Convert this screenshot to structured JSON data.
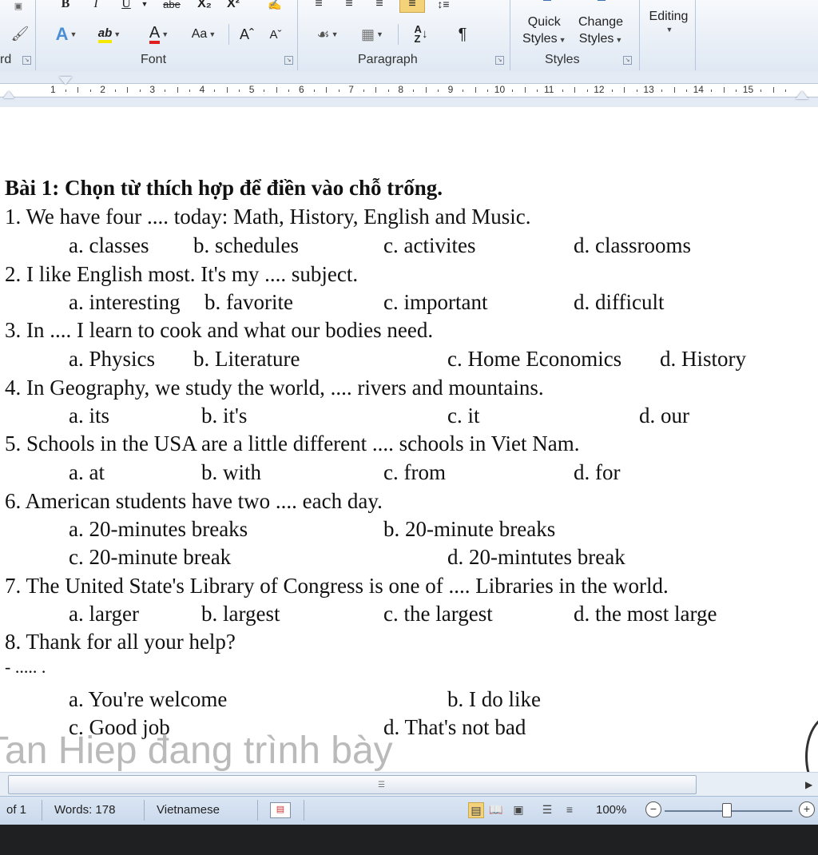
{
  "ribbon": {
    "font": {
      "bold": "B",
      "italic": "I",
      "underline": "U",
      "strike": "abe",
      "subscript": "X₂",
      "superscript": "X²",
      "font_color": "A",
      "highlight": "ab",
      "text_color": "A",
      "change_case": "Aa",
      "grow": "Aˆ",
      "shrink": "Aˇ",
      "label": "Font"
    },
    "paragraph": {
      "pilcrow": "¶",
      "label": "Paragraph"
    },
    "styles": {
      "quick_1": "Quick",
      "quick_2": "Styles",
      "change_1": "Change",
      "change_2": "Styles",
      "label": "Styles"
    },
    "editing": {
      "label": "Editing"
    },
    "clipboard_tail": "rd"
  },
  "ruler": {
    "numbers": [
      "1",
      "2",
      "3",
      "4",
      "5",
      "6",
      "7",
      "8",
      "9",
      "10",
      "11",
      "12",
      "13",
      "14",
      "15"
    ]
  },
  "document": {
    "title": "Bài 1: Chọn từ thích hợp để điền vào chỗ trống.",
    "questions": [
      {
        "q": "1. We have four .... today: Math, History, English and Music.",
        "a": "a. classes",
        "b": "b. schedules",
        "c": "c. activites",
        "d": "d. classrooms"
      },
      {
        "q": "2. I like English most. It's my .... subject.",
        "a": "a. interesting",
        "b": "b. favorite",
        "c": "c. important",
        "d": "d. difficult"
      },
      {
        "q": "3. In .... I learn to cook and what our bodies need.",
        "a": "a. Physics",
        "b": "b. Literature",
        "c": "c. Home Economics",
        "d": "d. History"
      },
      {
        "q": "4. In Geography, we study the world, .... rivers and mountains.",
        "a": "a. its",
        "b": "b. it's",
        "c": "c. it",
        "d": "d. our"
      },
      {
        "q": "5. Schools in the USA are a little different .... schools in Viet Nam.",
        "a": "a. at",
        "b": "b. with",
        "c": "c. from",
        "d": "d. for"
      },
      {
        "q": "6. American students have two .... each day.",
        "a": "a. 20-minutes breaks",
        "b": "b. 20-minute breaks",
        "c": "c. 20-minute break",
        "d": "d. 20-mintutes break"
      },
      {
        "q": "7. The United State's Library of Congress is one of .... Libraries in the world.",
        "a": "a. larger",
        "b": "b. largest",
        "c": "c. the largest",
        "d": "d. the most large"
      },
      {
        "q": "8. Thank for all your help?",
        "reply": "- ..... .",
        "a": "a. You're welcome",
        "b": "b. I do like",
        "c": "c. Good job",
        "d": "d. That's not bad"
      }
    ]
  },
  "overlay_text": "Tan Hiep đang trình bày",
  "status": {
    "page": "of 1",
    "words": "Words: 178",
    "language": "Vietnamese",
    "zoom": "100%",
    "zoom_minus": "−",
    "zoom_plus": "+"
  }
}
